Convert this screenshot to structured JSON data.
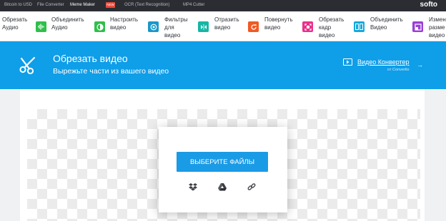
{
  "topbar": {
    "links": [
      "Bitcoin to USD",
      "File Converter",
      "Meme Maker",
      "OCR (Text Recognition)",
      "MP4 Cutter"
    ],
    "badge": "NEW",
    "logo": "softo"
  },
  "tools": [
    {
      "label": "Обрезать\nАудио",
      "color": "#ffffff",
      "icon": "cut-audio-icon"
    },
    {
      "label": "Объединить\nАудио",
      "color": "#2fbf4a",
      "icon": "waveform-icon"
    },
    {
      "label": "Настроить\nвидео",
      "color": "#2fbf4a",
      "icon": "adjust-icon"
    },
    {
      "label": "Фильтры\nдля\nвидео",
      "color": "#1a98c9",
      "icon": "filter-icon"
    },
    {
      "label": "Отразить\nвидео",
      "color": "#16b6a5",
      "icon": "flip-icon"
    },
    {
      "label": "Повернуть\nвидео",
      "color": "#f05a24",
      "icon": "rotate-icon"
    },
    {
      "label": "Обрезать\nкадр\nвидео",
      "color": "#e8328c",
      "icon": "crop-icon"
    },
    {
      "label": "Объединить\nВидео",
      "color": "#14a9dc",
      "icon": "merge-video-icon"
    },
    {
      "label": "Измен\nразме\nвидео",
      "color": "#9b3fd6",
      "icon": "resize-icon"
    }
  ],
  "banner": {
    "title": "Обрезать видео",
    "subtitle": "Вырежьте части из вашего видео",
    "converter_title": "Видео Конвертер",
    "converter_sub": "от Convertio",
    "color": "#0f9ee8"
  },
  "upload": {
    "button_label": "ВЫБЕРИТЕ ФАЙЛЫ",
    "sources": [
      "dropbox-icon",
      "google-drive-icon",
      "url-link-icon"
    ]
  }
}
